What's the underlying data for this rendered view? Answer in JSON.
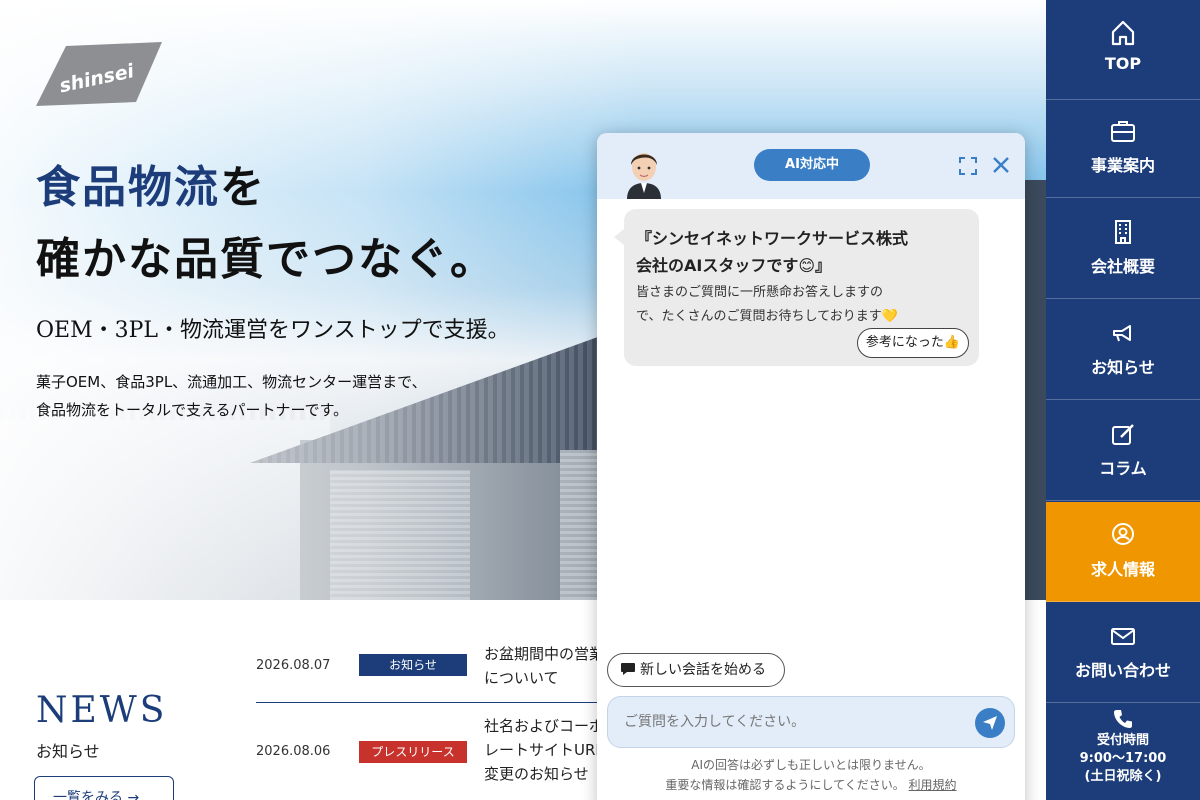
{
  "logo": {
    "text": "SHINSEI"
  },
  "hero": {
    "headline_blue": "食品物流",
    "headline_rest": "を",
    "headline_line2": "確かな品質でつなぐ。",
    "subline": "OEM・3PL・物流運営をワンストップで支援。",
    "desc_line1": "菓子OEM、食品3PL、流通加工、物流センター運営まで、",
    "desc_line2": "食品物流をトータルで支えるパートナーです。"
  },
  "news": {
    "title": "NEWS",
    "subtitle": "お知らせ",
    "more_label": "一覧をみる →",
    "items": [
      {
        "date": "2026.08.07",
        "badge": "お知らせ",
        "badge_color": "#1c3d7a",
        "text": "お盆期間中の営業についいて"
      },
      {
        "date": "2026.08.06",
        "badge": "プレスリリース",
        "badge_color": "#c8322c",
        "text": "社名およびコーポレートサイトURL変更のお知らせ"
      }
    ]
  },
  "sidebar": {
    "items": [
      {
        "label": "TOP",
        "icon": "home-icon"
      },
      {
        "label": "事業案内",
        "icon": "briefcase-icon"
      },
      {
        "label": "会社概要",
        "icon": "building-icon"
      },
      {
        "label": "お知らせ",
        "icon": "megaphone-icon"
      },
      {
        "label": "コラム",
        "icon": "edit-icon"
      },
      {
        "label": "求人情報",
        "icon": "person-search-icon"
      },
      {
        "label": "お問い合わせ",
        "icon": "mail-icon"
      }
    ],
    "hours_title": "受付時間",
    "hours_time": "9:00〜17:00",
    "hours_note": "(土日祝除く)"
  },
  "chat": {
    "status": "AI対応中",
    "message_title_1": "『シンセイネットワークサービス株式",
    "message_title_2": "会社のAIスタッフです😊』",
    "message_body_1": "皆さまのご質問に一所懸命お答えしますの",
    "message_body_2": "で、たくさんのご質問お待ちしております💛",
    "helpful_label": "参考になった👍",
    "new_chat_label": "新しい会話を始める",
    "input_placeholder": "ご質問を入力してください。",
    "disclaimer_1": "AIの回答は必ずしも正しいとは限りません。",
    "disclaimer_2": "重要な情報は確認するようにしてください。",
    "terms_link": "利用規約"
  },
  "colors": {
    "navy": "#1c3d7a",
    "orange": "#ef9600",
    "chat_blue": "#3a7fc6"
  }
}
